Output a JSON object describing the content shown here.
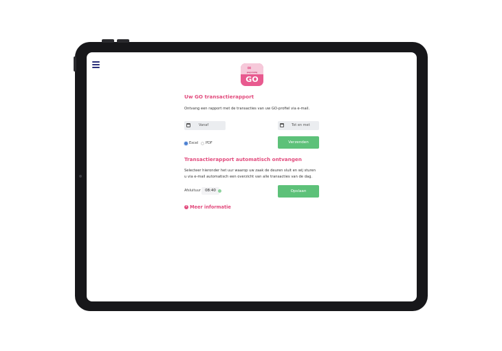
{
  "app": {
    "logo": {
      "link_glyph": "∞",
      "brand_text": "payconiq",
      "go_text": "GO"
    }
  },
  "report": {
    "title": "Uw GO transactierapport",
    "description": "Ontvang een rapport met de transacties van uw GO-profiel via e-mail.",
    "date_from_placeholder": "Vanaf",
    "date_to_placeholder": "Tot en met",
    "format_options": [
      "Excel",
      "PDF"
    ],
    "selected_format": "Excel",
    "send_button": "Verzenden"
  },
  "auto_report": {
    "title": "Transactierapport automatisch ontvangen",
    "description_line1": "Selecteer hieronder het uur waarop uw zaak de deuren sluit en wij sturen",
    "description_line2": "u via e-mail automatisch een overzicht van alle transacties van de dag.",
    "closing_label": "Afsluituur",
    "closing_time": "08:40",
    "save_button": "Opslaan"
  },
  "more_info": {
    "icon": "i",
    "label": "Meer informatie"
  },
  "colors": {
    "accent": "#e24b7d",
    "button": "#5dc179",
    "nav": "#2a2f7a",
    "device": "#17171a"
  }
}
